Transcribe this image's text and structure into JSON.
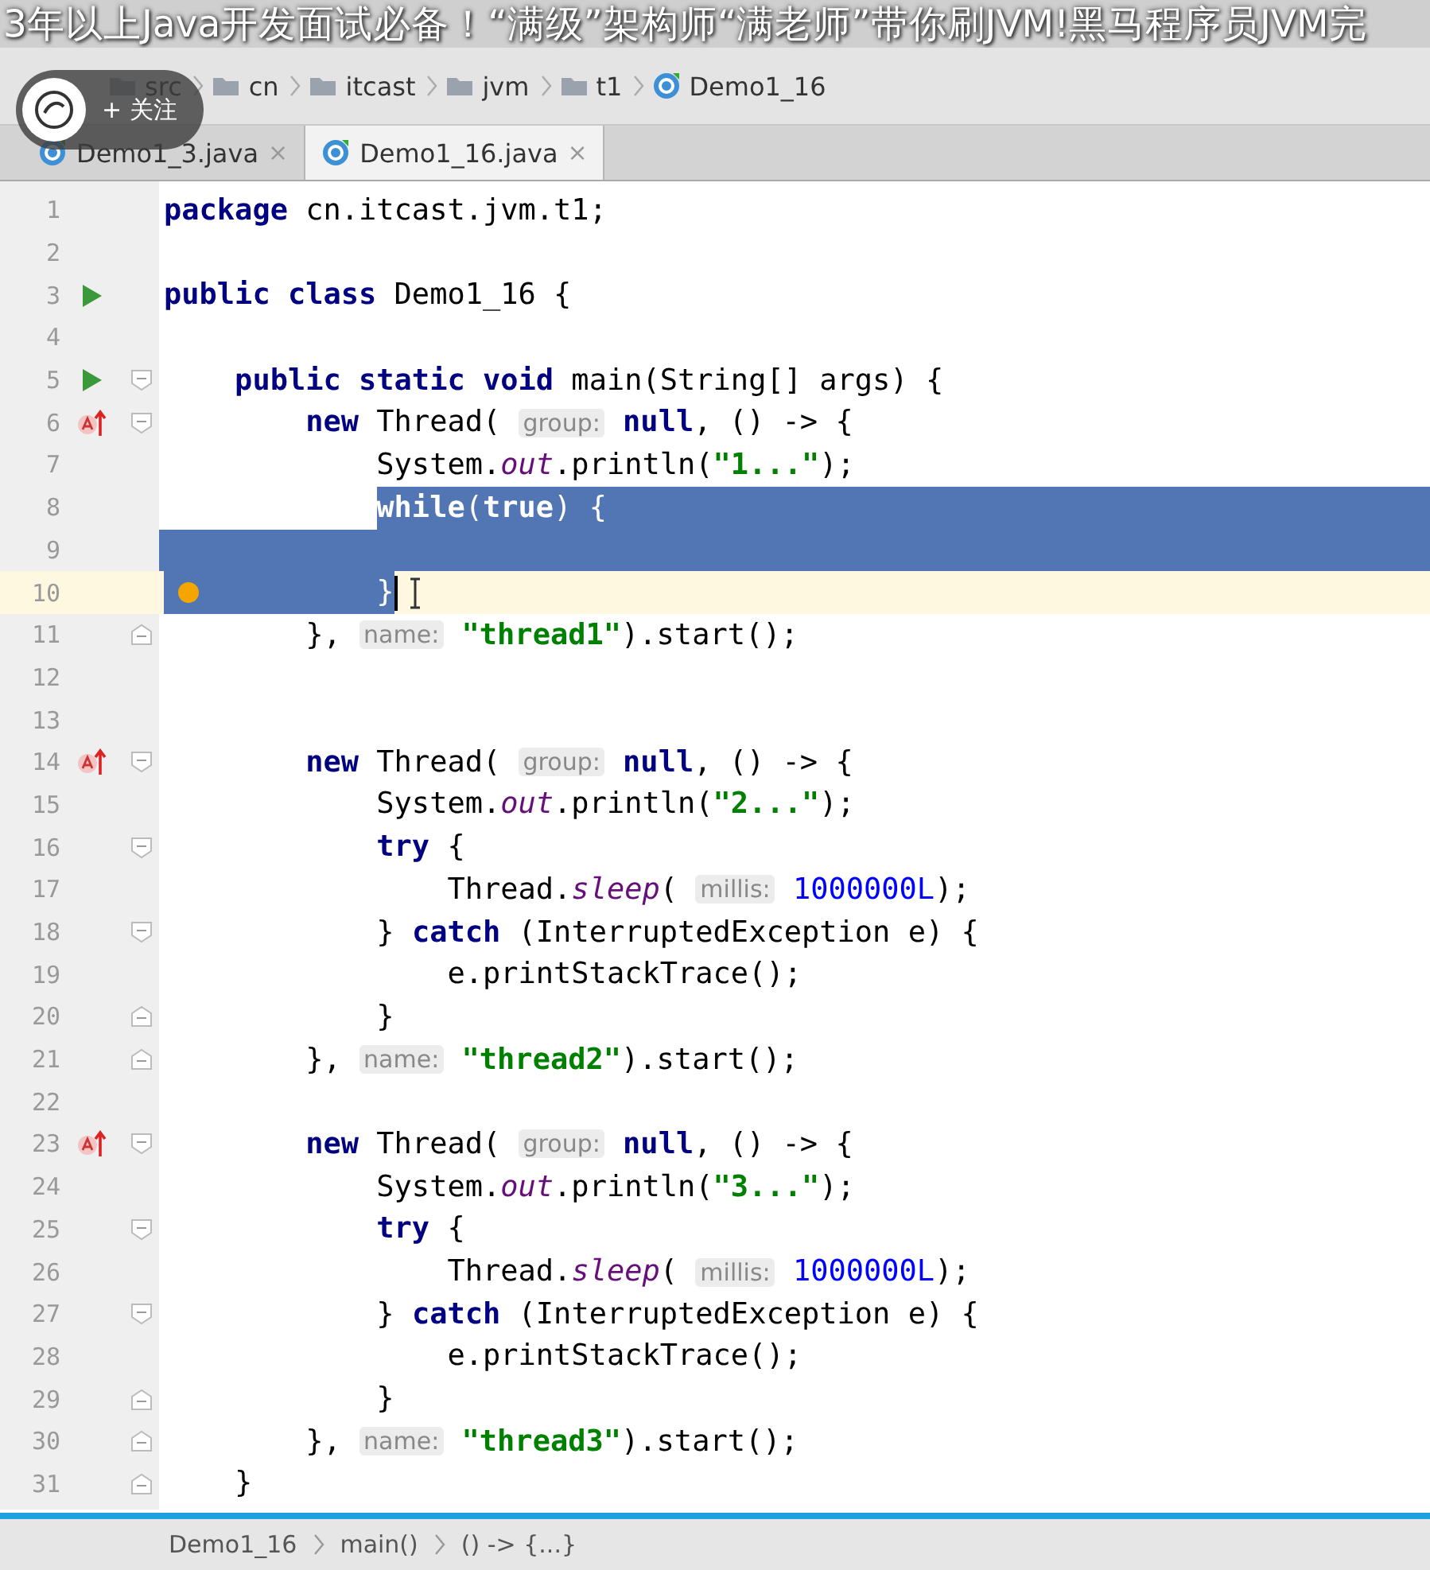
{
  "video_title": "3年以上Java开发面试必备！“满级”架构师“满老师”带你刷JVM!黑马程序员JVM完",
  "follow_button": {
    "label": "+ 关注"
  },
  "breadcrumbs": [
    {
      "text": "src",
      "kind": "folder"
    },
    {
      "text": "cn",
      "kind": "folder"
    },
    {
      "text": "itcast",
      "kind": "folder"
    },
    {
      "text": "jvm",
      "kind": "folder"
    },
    {
      "text": "t1",
      "kind": "folder"
    },
    {
      "text": "Demo1_16",
      "kind": "class"
    }
  ],
  "tabs": [
    {
      "label": "Demo1_3.java",
      "selected": false,
      "close": "×"
    },
    {
      "label": "Demo1_16.java",
      "selected": true,
      "close": "×"
    }
  ],
  "lines": [
    {
      "number": "1",
      "tokens": [
        {
          "kind": "kw",
          "text": "package"
        },
        {
          "kind": "plain",
          "text": " cn.itcast.jvm.t1;"
        }
      ]
    },
    {
      "number": "2"
    },
    {
      "number": "3",
      "run": true,
      "tokens": [
        {
          "kind": "kw",
          "text": "public class"
        },
        {
          "kind": "plain",
          "text": " Demo1_16 {"
        }
      ]
    },
    {
      "number": "4"
    },
    {
      "number": "5",
      "run": true,
      "fold_start": true,
      "tokens": [
        {
          "kind": "kw",
          "text": "    public static void"
        },
        {
          "kind": "plain",
          "text": " main(String[] args) {"
        }
      ]
    },
    {
      "number": "6",
      "override": true,
      "fold_start": true,
      "tokens": [
        {
          "kind": "kw",
          "text": "        new"
        },
        {
          "kind": "plain",
          "text": " Thread( "
        },
        {
          "kind": "hint",
          "text": "group:"
        },
        {
          "kind": "kw",
          "text": " null"
        },
        {
          "kind": "plain",
          "text": ", () -> {"
        }
      ]
    },
    {
      "number": "7",
      "tokens": [
        {
          "kind": "plain",
          "text": "            System."
        },
        {
          "kind": "field",
          "text": "out"
        },
        {
          "kind": "plain",
          "text": ".println("
        },
        {
          "kind": "str",
          "text": "\"1...\""
        },
        {
          "kind": "plain",
          "text": ");"
        }
      ]
    },
    {
      "number": "8",
      "selected": true,
      "tokens": [
        {
          "kind": "kw",
          "text": "            while"
        },
        {
          "kind": "plain",
          "text": "("
        },
        {
          "kind": "kw",
          "text": "true"
        },
        {
          "kind": "plain",
          "text": ") {"
        }
      ]
    },
    {
      "number": "9",
      "selected": true
    },
    {
      "number": "10",
      "selected": true,
      "current": true,
      "bookmark": true,
      "tokens": [
        {
          "kind": "plain",
          "text": "            }"
        }
      ]
    },
    {
      "number": "11",
      "fold_end": true,
      "tokens": [
        {
          "kind": "plain",
          "text": "        }, "
        },
        {
          "kind": "hint",
          "text": "name:"
        },
        {
          "kind": "str",
          "text": " \"thread1\""
        },
        {
          "kind": "plain",
          "text": ").start();"
        }
      ]
    },
    {
      "number": "12"
    },
    {
      "number": "13"
    },
    {
      "number": "14",
      "override": true,
      "fold_start": true,
      "tokens": [
        {
          "kind": "kw",
          "text": "        new"
        },
        {
          "kind": "plain",
          "text": " Thread( "
        },
        {
          "kind": "hint",
          "text": "group:"
        },
        {
          "kind": "kw",
          "text": " null"
        },
        {
          "kind": "plain",
          "text": ", () -> {"
        }
      ]
    },
    {
      "number": "15",
      "tokens": [
        {
          "kind": "plain",
          "text": "            System."
        },
        {
          "kind": "field",
          "text": "out"
        },
        {
          "kind": "plain",
          "text": ".println("
        },
        {
          "kind": "str",
          "text": "\"2...\""
        },
        {
          "kind": "plain",
          "text": ");"
        }
      ]
    },
    {
      "number": "16",
      "fold_start": true,
      "tokens": [
        {
          "kind": "kw",
          "text": "            try"
        },
        {
          "kind": "plain",
          "text": " {"
        }
      ]
    },
    {
      "number": "17",
      "tokens": [
        {
          "kind": "plain",
          "text": "                Thread."
        },
        {
          "kind": "field",
          "text": "sleep"
        },
        {
          "kind": "plain",
          "text": "( "
        },
        {
          "kind": "hint",
          "text": "millis:"
        },
        {
          "kind": "num",
          "text": " 1000000L"
        },
        {
          "kind": "plain",
          "text": ");"
        }
      ]
    },
    {
      "number": "18",
      "fold_start": true,
      "tokens": [
        {
          "kind": "plain",
          "text": "            } "
        },
        {
          "kind": "kw",
          "text": "catch"
        },
        {
          "kind": "plain",
          "text": " (InterruptedException e) {"
        }
      ]
    },
    {
      "number": "19",
      "tokens": [
        {
          "kind": "plain",
          "text": "                e.printStackTrace();"
        }
      ]
    },
    {
      "number": "20",
      "fold_end": true,
      "tokens": [
        {
          "kind": "plain",
          "text": "            }"
        }
      ]
    },
    {
      "number": "21",
      "fold_end": true,
      "tokens": [
        {
          "kind": "plain",
          "text": "        }, "
        },
        {
          "kind": "hint",
          "text": "name:"
        },
        {
          "kind": "str",
          "text": " \"thread2\""
        },
        {
          "kind": "plain",
          "text": ").start();"
        }
      ]
    },
    {
      "number": "22"
    },
    {
      "number": "23",
      "override": true,
      "fold_start": true,
      "tokens": [
        {
          "kind": "kw",
          "text": "        new"
        },
        {
          "kind": "plain",
          "text": " Thread( "
        },
        {
          "kind": "hint",
          "text": "group:"
        },
        {
          "kind": "kw",
          "text": " null"
        },
        {
          "kind": "plain",
          "text": ", () -> {"
        }
      ]
    },
    {
      "number": "24",
      "tokens": [
        {
          "kind": "plain",
          "text": "            System."
        },
        {
          "kind": "field",
          "text": "out"
        },
        {
          "kind": "plain",
          "text": ".println("
        },
        {
          "kind": "str",
          "text": "\"3...\""
        },
        {
          "kind": "plain",
          "text": ");"
        }
      ]
    },
    {
      "number": "25",
      "fold_start": true,
      "tokens": [
        {
          "kind": "kw",
          "text": "            try"
        },
        {
          "kind": "plain",
          "text": " {"
        }
      ]
    },
    {
      "number": "26",
      "tokens": [
        {
          "kind": "plain",
          "text": "                Thread."
        },
        {
          "kind": "field",
          "text": "sleep"
        },
        {
          "kind": "plain",
          "text": "( "
        },
        {
          "kind": "hint",
          "text": "millis:"
        },
        {
          "kind": "num",
          "text": " 1000000L"
        },
        {
          "kind": "plain",
          "text": ");"
        }
      ]
    },
    {
      "number": "27",
      "fold_start": true,
      "tokens": [
        {
          "kind": "plain",
          "text": "            } "
        },
        {
          "kind": "kw",
          "text": "catch"
        },
        {
          "kind": "plain",
          "text": " (InterruptedException e) {"
        }
      ]
    },
    {
      "number": "28",
      "tokens": [
        {
          "kind": "plain",
          "text": "                e.printStackTrace();"
        }
      ]
    },
    {
      "number": "29",
      "fold_end": true,
      "tokens": [
        {
          "kind": "plain",
          "text": "            }"
        }
      ]
    },
    {
      "number": "30",
      "fold_end": true,
      "tokens": [
        {
          "kind": "plain",
          "text": "        }, "
        },
        {
          "kind": "hint",
          "text": "name:"
        },
        {
          "kind": "str",
          "text": " \"thread3\""
        },
        {
          "kind": "plain",
          "text": ").start();"
        }
      ]
    },
    {
      "number": "31",
      "fold_end": true,
      "tokens": [
        {
          "kind": "plain",
          "text": "    }"
        }
      ]
    }
  ],
  "status_breadcrumbs": [
    "Demo1_16",
    "main()",
    "() -> {...}"
  ]
}
